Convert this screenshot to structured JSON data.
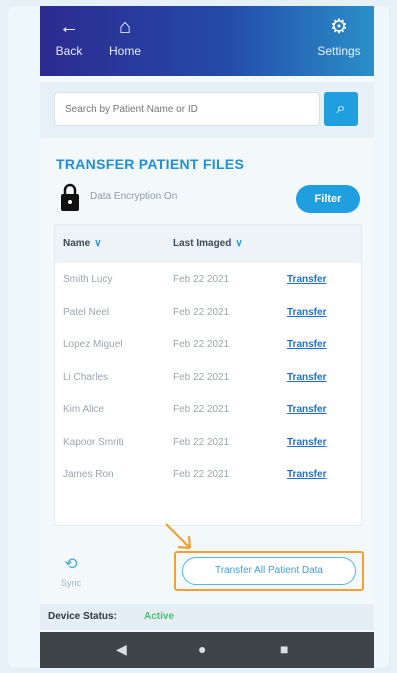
{
  "nav": {
    "back_label": "Back",
    "home_label": "Home",
    "settings_label": "Settings",
    "back_icon": "arrow-left-icon",
    "home_icon": "home-icon",
    "settings_icon": "gear-icon"
  },
  "search": {
    "placeholder": "Search by Patient Name or ID",
    "button_icon": "search-icon"
  },
  "page": {
    "title": "TRANSFER PATIENT FILES",
    "subtitle": "Data Encryption On",
    "filter_label": "Filter",
    "lock_icon": "lock-icon"
  },
  "table": {
    "columns": [
      {
        "label": "Name",
        "sort_icon": "chevron-down-icon"
      },
      {
        "label": "Last Imaged",
        "sort_icon": "chevron-down-icon"
      },
      {
        "label": ""
      }
    ],
    "rows": [
      {
        "name": "Smith Lucy",
        "date": "Feb 22 2021",
        "action": "Transfer"
      },
      {
        "name": "Patel Neel",
        "date": "Feb 22 2021",
        "action": "Transfer"
      },
      {
        "name": "Lopez Miguel",
        "date": "Feb 22 2021",
        "action": "Transfer"
      },
      {
        "name": "Li Charles",
        "date": "Feb 22 2021",
        "action": "Transfer"
      },
      {
        "name": "Kim Alice",
        "date": "Feb 22 2021",
        "action": "Transfer"
      },
      {
        "name": "Kapoor Smriti",
        "date": "Feb 22 2021",
        "action": "Transfer"
      },
      {
        "name": "James Ron",
        "date": "Feb 22 2021",
        "action": "Transfer"
      }
    ]
  },
  "footer": {
    "sync_label": "Sync",
    "sync_icon": "sync-icon",
    "transfer_all_label": "Transfer All Patient Data",
    "status_label": "Device Status:",
    "status_value": "Active"
  },
  "android_nav": {
    "back_icon": "triangle-back-icon",
    "home_icon": "circle-home-icon",
    "recents_icon": "square-recents-icon"
  },
  "colors": {
    "accent": "#1f9ee0",
    "highlight": "#f1a035",
    "status_active": "#4bbf73",
    "header_start": "#2d2a8f",
    "header_end": "#2a8fc9"
  }
}
